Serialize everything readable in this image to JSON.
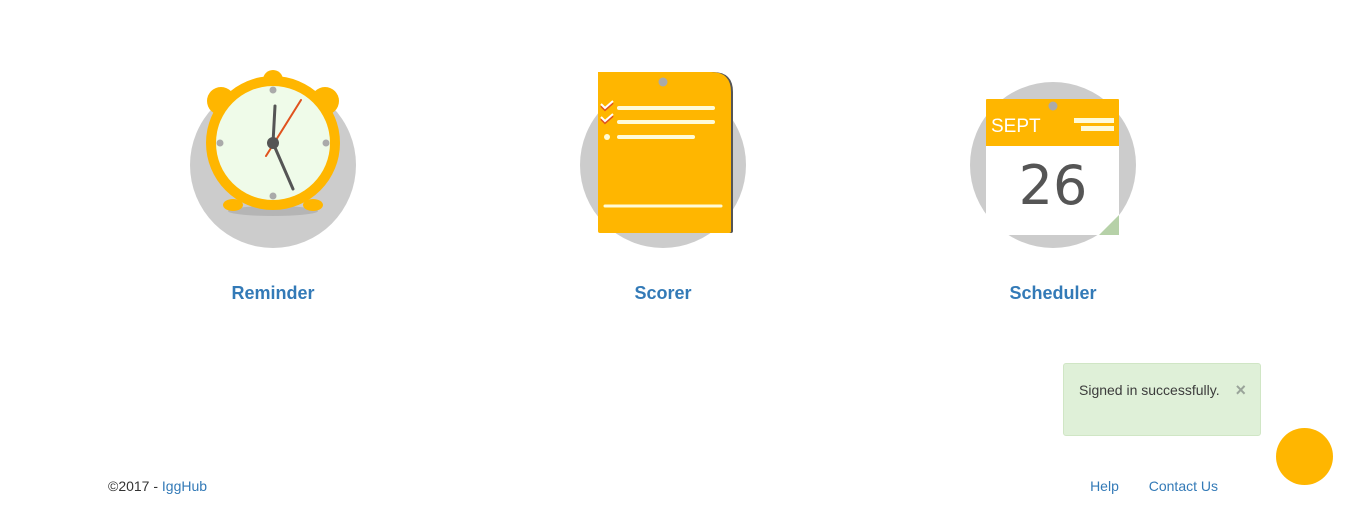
{
  "features": [
    {
      "label": "Reminder",
      "icon": "alarm-clock-icon"
    },
    {
      "label": "Scorer",
      "icon": "checklist-icon"
    },
    {
      "label": "Scheduler",
      "icon": "calendar-icon",
      "calendar": {
        "month": "SEPT",
        "day": "26"
      }
    }
  ],
  "flash": {
    "message": "Signed in successfully.",
    "close_label": "×"
  },
  "footer": {
    "copyright": "©2017 - ",
    "brand": "IggHub",
    "links": {
      "help": "Help",
      "contact": "Contact Us"
    }
  },
  "colors": {
    "accent": "#ffb600",
    "link": "#337ab7",
    "circle": "#cccccc",
    "flash_bg": "#dff0d8"
  }
}
